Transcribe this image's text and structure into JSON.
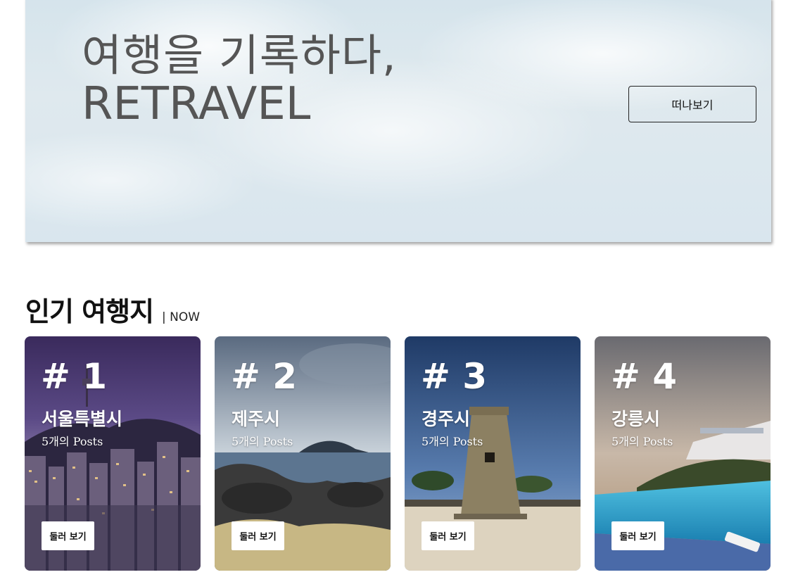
{
  "hero": {
    "title_line1": "여행을 기록하다,",
    "title_line2": "RETRAVEL",
    "cta_label": "떠나보기"
  },
  "section": {
    "title": "인기 여행지",
    "subtitle": "| NOW"
  },
  "cards": [
    {
      "rank": "# 1",
      "name": "서울특별시",
      "posts": "5개의 Posts",
      "button": "둘러 보기"
    },
    {
      "rank": "# 2",
      "name": "제주시",
      "posts": "5개의 Posts",
      "button": "둘러 보기"
    },
    {
      "rank": "# 3",
      "name": "경주시",
      "posts": "5개의 Posts",
      "button": "둘러 보기"
    },
    {
      "rank": "# 4",
      "name": "강릉시",
      "posts": "5개의 Posts",
      "button": "둘러 보기"
    }
  ]
}
